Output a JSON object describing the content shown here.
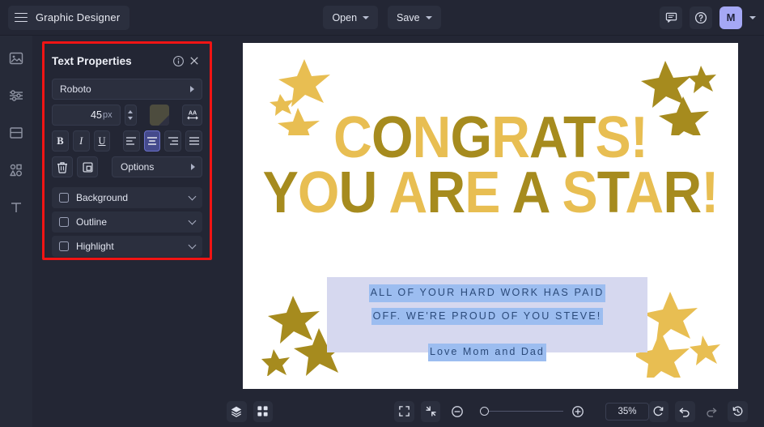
{
  "header": {
    "menu_icon": "hamburger-icon",
    "brand_title": "Graphic Designer",
    "open_label": "Open",
    "save_label": "Save",
    "comment_icon": "comment-icon",
    "help_icon": "help-circle-icon",
    "avatar_initial": "M",
    "avatar_chevron": "chevron-down-icon"
  },
  "rail": {
    "items": [
      {
        "icon": "image-icon",
        "name": "images"
      },
      {
        "icon": "sliders-icon",
        "name": "adjustments"
      },
      {
        "icon": "layout-icon",
        "name": "templates"
      },
      {
        "icon": "shapes-icon",
        "name": "shapes"
      },
      {
        "icon": "text-icon",
        "name": "text"
      }
    ]
  },
  "panel": {
    "title": "Text Properties",
    "info_icon": "info-icon",
    "close_icon": "close-icon",
    "font_family": "Roboto",
    "font_size_value": "45",
    "font_size_unit": "px",
    "color_swatch": "#4d4c3e",
    "letter_spacing_icon": "letter-spacing-icon",
    "bold_label": "B",
    "italic_label": "I",
    "underline_label": "U",
    "align": {
      "left": "align-left-icon",
      "center": "align-center-icon",
      "right": "align-right-icon",
      "justify": "align-justify-icon",
      "selected": "center"
    },
    "delete_icon": "trash-icon",
    "duplicate_icon": "duplicate-icon",
    "options_label": "Options",
    "sections": [
      {
        "label": "Background",
        "checked": false
      },
      {
        "label": "Outline",
        "checked": false
      },
      {
        "label": "Highlight",
        "checked": false
      }
    ],
    "highlight_border_color": "#f11414"
  },
  "canvas": {
    "background": "#ffffff",
    "gold_light": "#e8be52",
    "gold_dark": "#a68b1e",
    "headline_line1": [
      {
        "t": "C",
        "shade": "light"
      },
      {
        "t": "O",
        "shade": "dark"
      },
      {
        "t": "N",
        "shade": "light"
      },
      {
        "t": "G",
        "shade": "dark"
      },
      {
        "t": "R",
        "shade": "light"
      },
      {
        "t": "A",
        "shade": "dark"
      },
      {
        "t": "T",
        "shade": "dark"
      },
      {
        "t": "S",
        "shade": "light"
      },
      {
        "t": "!",
        "shade": "light"
      }
    ],
    "headline_line2": [
      {
        "t": "Y",
        "shade": "dark"
      },
      {
        "t": "O",
        "shade": "light"
      },
      {
        "t": "U",
        "shade": "dark"
      },
      {
        "t": " ",
        "shade": "light"
      },
      {
        "t": "A",
        "shade": "light"
      },
      {
        "t": "R",
        "shade": "dark"
      },
      {
        "t": "E",
        "shade": "light"
      },
      {
        "t": " ",
        "shade": "light"
      },
      {
        "t": "A",
        "shade": "dark"
      },
      {
        "t": " ",
        "shade": "light"
      },
      {
        "t": "S",
        "shade": "light"
      },
      {
        "t": "T",
        "shade": "dark"
      },
      {
        "t": "A",
        "shade": "light"
      },
      {
        "t": "R",
        "shade": "dark"
      },
      {
        "t": "!",
        "shade": "light"
      }
    ],
    "textbox": {
      "background": "#d6d8ef",
      "selection_color": "#9cbdf0",
      "text_color": "#2b4a7a",
      "line1": "ALL OF YOUR HARD WORK HAS PAID",
      "line2": "OFF. WE'RE PROUD OF YOU STEVE!",
      "line3": "Love Mom and Dad"
    },
    "star_clusters": [
      {
        "name": "top-left",
        "shade": "light"
      },
      {
        "name": "top-right",
        "shade": "dark"
      },
      {
        "name": "bottom-left",
        "shade": "dark"
      },
      {
        "name": "bottom-right",
        "shade": "light"
      }
    ]
  },
  "bottom": {
    "layers_icon": "layers-icon",
    "grid_icon": "grid-icon",
    "fit_icon": "fit-screen-icon",
    "collapse_icon": "collapse-icon",
    "zoom_out_icon": "zoom-out-icon",
    "zoom_in_icon": "zoom-in-icon",
    "zoom_value": "35%",
    "reset_icon": "reset-icon",
    "undo_icon": "undo-icon",
    "redo_icon": "redo-icon",
    "history_icon": "history-icon"
  }
}
